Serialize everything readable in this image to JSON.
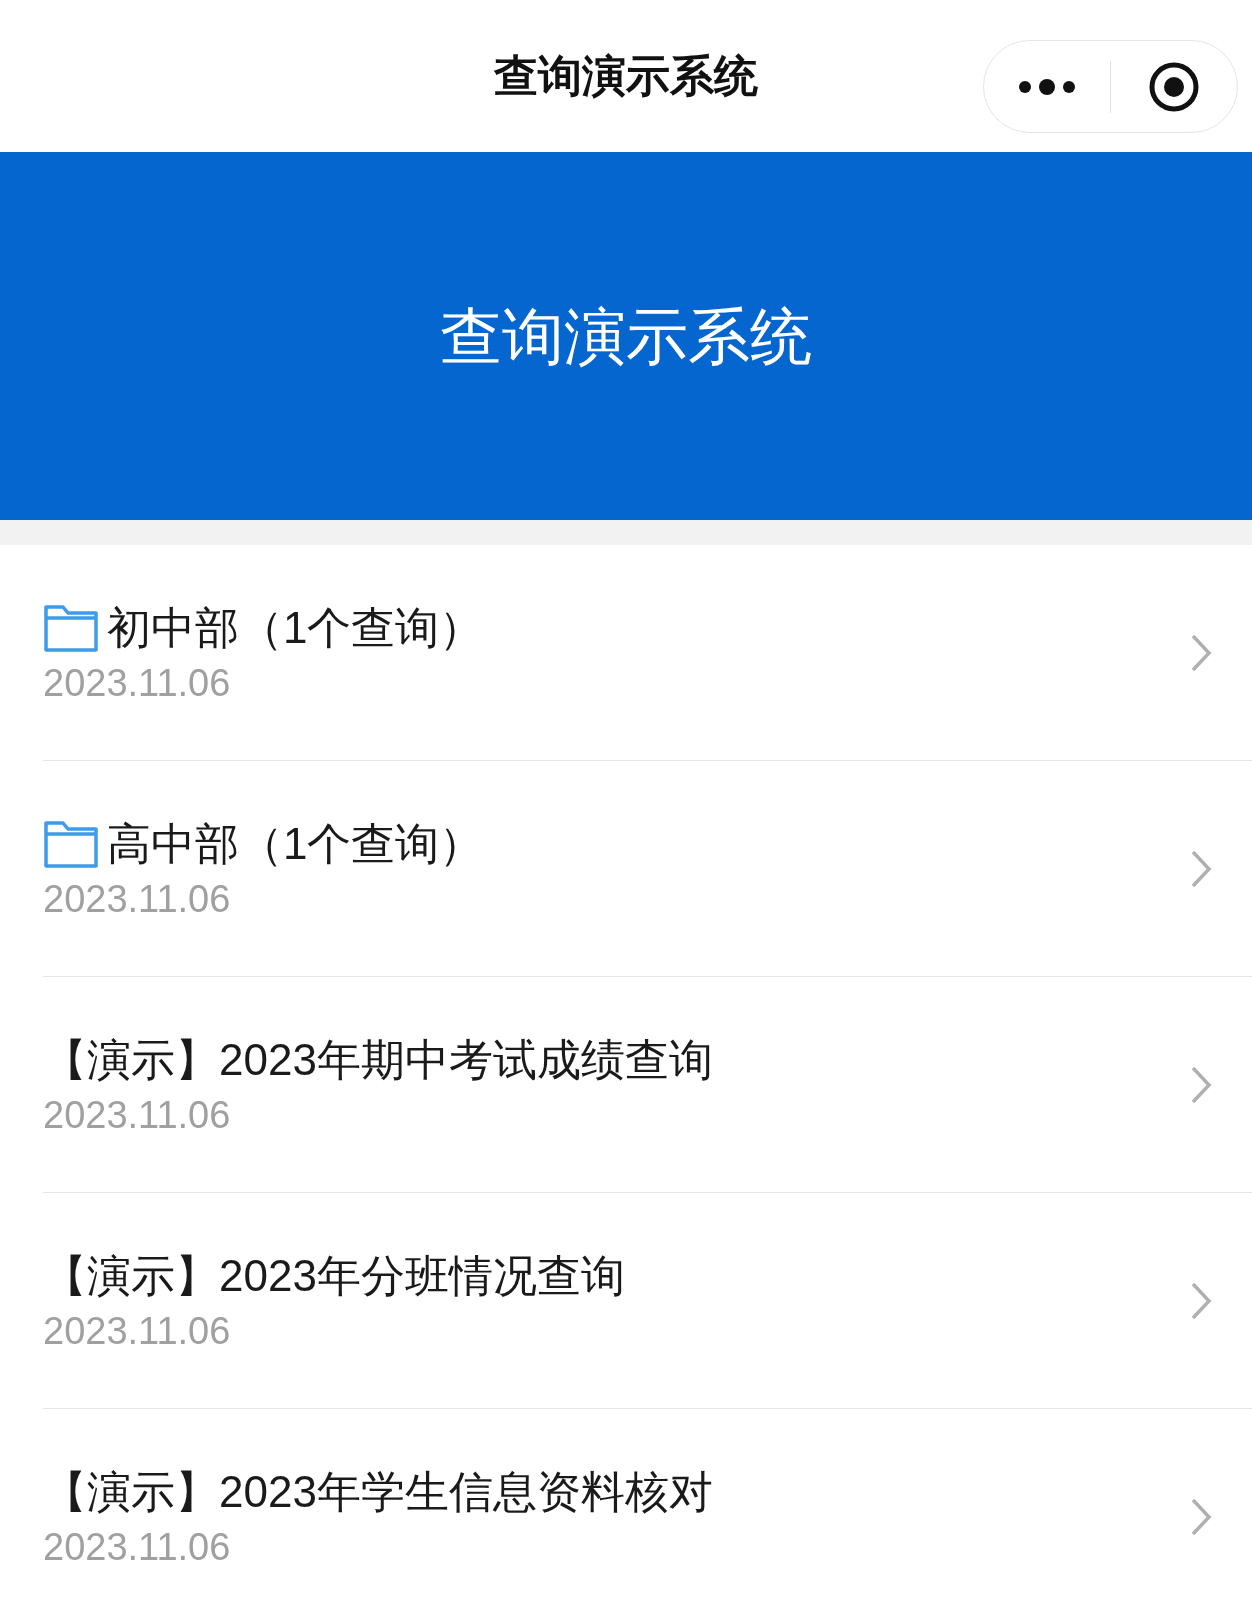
{
  "nav_bar": {
    "title": "查询演示系统"
  },
  "banner": {
    "title": "查询演示系统"
  },
  "items": [
    {
      "kind": "folder",
      "title": "初中部（1个查询）",
      "date": "2023.11.06"
    },
    {
      "kind": "folder",
      "title": "高中部（1个查询）",
      "date": "2023.11.06"
    },
    {
      "kind": "query",
      "title": "【演示】2023年期中考试成绩查询",
      "date": "2023.11.06"
    },
    {
      "kind": "query",
      "title": "【演示】2023年分班情况查询",
      "date": "2023.11.06"
    },
    {
      "kind": "query",
      "title": "【演示】2023年学生信息资料核对",
      "date": "2023.11.06"
    }
  ]
}
